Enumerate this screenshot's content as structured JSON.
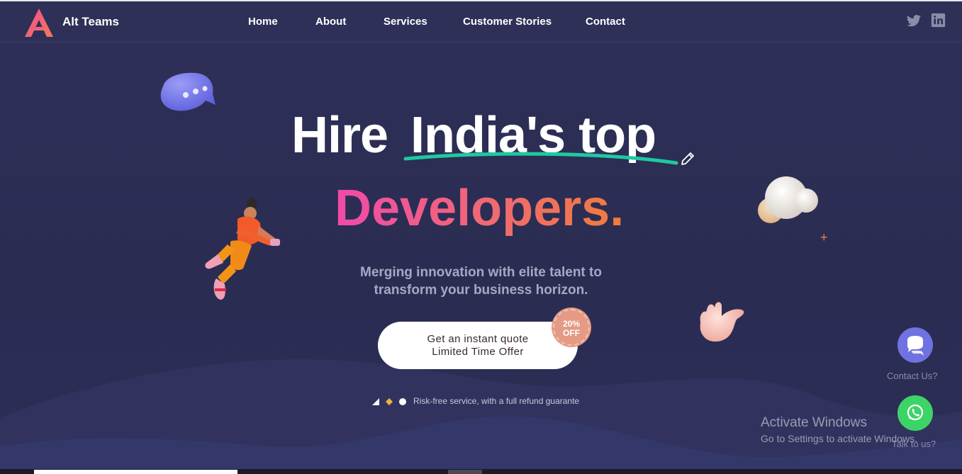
{
  "brand": {
    "name": "Alt Teams",
    "logo_icon": "alt-teams-logo-icon"
  },
  "nav": {
    "items": [
      {
        "label": "Home"
      },
      {
        "label": "About"
      },
      {
        "label": "Services"
      },
      {
        "label": "Customer Stories"
      },
      {
        "label": "Contact"
      }
    ]
  },
  "social": {
    "twitter_icon": "twitter-icon",
    "linkedin_icon": "linkedin-icon"
  },
  "hero": {
    "line1_a": "Hire",
    "line1_b": "India's top",
    "line2": "Developers.",
    "subtitle_line1": "Merging innovation with elite talent to",
    "subtitle_line2": "transform your business horizon.",
    "cta_line1": "Get an instant quote",
    "cta_line2": "Limited Time Offer",
    "badge_line1": "20%",
    "badge_line2": "OFF",
    "risk_text": "Risk-free service, with a full refund guarante"
  },
  "widgets": {
    "contact_label": "Contact Us?",
    "talk_label": "Talk to us?"
  },
  "watermark": {
    "title": "Activate Windows",
    "subtitle": "Go to Settings to activate Windows."
  },
  "colors": {
    "background": "#2c2e56",
    "accent_pink": "#f04aa8",
    "accent_orange": "#f07c3c",
    "underline_green": "#1fc9a0",
    "chat_button": "#6f72e0",
    "whatsapp_button": "#3dd467",
    "badge": "#e49a84"
  }
}
